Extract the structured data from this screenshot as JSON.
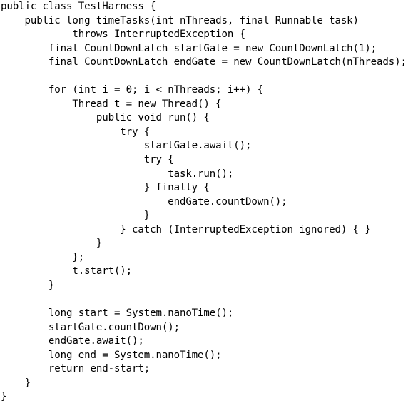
{
  "code": {
    "lines": [
      "public class TestHarness {",
      "    public long timeTasks(int nThreads, final Runnable task)",
      "            throws InterruptedException {",
      "        final CountDownLatch startGate = new CountDownLatch(1);",
      "        final CountDownLatch endGate = new CountDownLatch(nThreads);",
      "",
      "        for (int i = 0; i < nThreads; i++) {",
      "            Thread t = new Thread() {",
      "                public void run() {",
      "                    try {",
      "                        startGate.await();",
      "                        try {",
      "                            task.run();",
      "                        } finally {",
      "                            endGate.countDown();",
      "                        }",
      "                    } catch (InterruptedException ignored) { }",
      "                }",
      "            };",
      "            t.start();",
      "        }",
      "",
      "        long start = System.nanoTime();",
      "        startGate.countDown();",
      "        endGate.await();",
      "        long end = System.nanoTime();",
      "        return end-start;",
      "    }",
      "}"
    ]
  }
}
